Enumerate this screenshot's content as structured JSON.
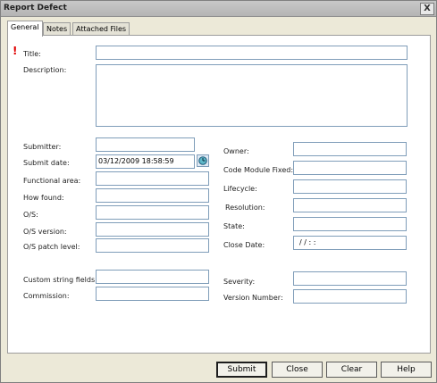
{
  "window": {
    "title": "Report Defect",
    "close_glyph": "X"
  },
  "tabs": [
    {
      "label": "General",
      "active": true
    },
    {
      "label": "Notes",
      "active": false
    },
    {
      "label": "Attached Files",
      "active": false
    }
  ],
  "required_marker": "!",
  "left_fields": {
    "title": {
      "label": "Title:",
      "value": ""
    },
    "description": {
      "label": "Description:",
      "value": ""
    },
    "submitter": {
      "label": "Submitter:",
      "value": ""
    },
    "submit_date": {
      "label": "Submit date:",
      "value": "03/12/2009 18:58:59"
    },
    "functional_area": {
      "label": "Functional area:",
      "value": ""
    },
    "how_found": {
      "label": "How found:",
      "value": ""
    },
    "os": {
      "label": "O/S:",
      "value": ""
    },
    "os_version": {
      "label": "O/S version:",
      "value": ""
    },
    "os_patch_level": {
      "label": "O/S patch level:",
      "value": ""
    },
    "custom_string_fields": {
      "label": "Custom string fields:",
      "value": ""
    },
    "commission": {
      "label": "Commission:",
      "value": ""
    }
  },
  "right_fields": {
    "owner": {
      "label": "Owner:",
      "value": ""
    },
    "code_module_fixed": {
      "label": "Code Module Fixed:",
      "value": ""
    },
    "lifecycle": {
      "label": "Lifecycle:",
      "value": ""
    },
    "resolution": {
      "label": "Resolution:",
      "value": ""
    },
    "state": {
      "label": "State:",
      "value": ""
    },
    "close_date": {
      "label": "Close Date:",
      "value": "/ /      : :"
    },
    "severity": {
      "label": "Severity:",
      "value": ""
    },
    "version_number": {
      "label": "Version Number:",
      "value": ""
    }
  },
  "icons": {
    "calendar": "calendar-clock-icon"
  },
  "buttons": {
    "submit": "Submit",
    "close": "Close",
    "clear": "Clear",
    "help": "Help"
  }
}
